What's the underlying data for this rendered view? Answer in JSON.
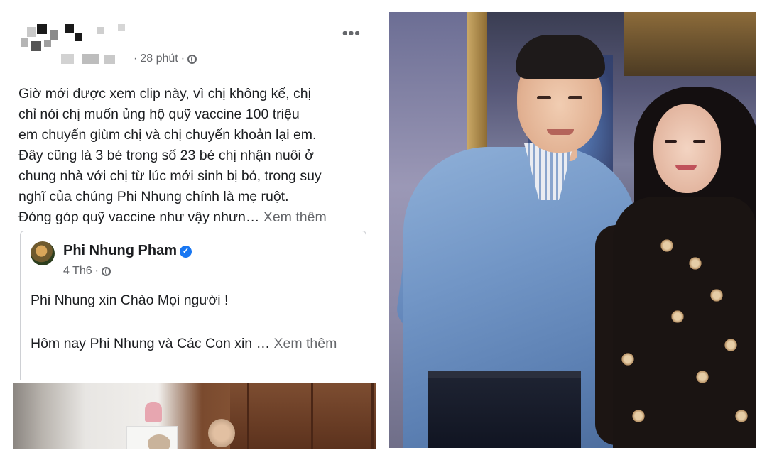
{
  "post": {
    "time_ago": "28 phút",
    "separator": "·",
    "more_label": "•••",
    "body_lines": [
      "Giờ mới được xem clip này, vì chị không kể, chị",
      "chỉ nói chị muốn ủng hộ quỹ vaccine 100 triệu",
      "em chuyển giùm chị và chị chuyển khoản lại em.",
      "Đây cũng là 3 bé trong số 23 bé chị nhận nuôi ở",
      "chung nhà với chị từ lúc mới sinh bị bỏ, trong suy",
      "nghĩ của chúng Phi Nhung chính là mẹ ruột.",
      "Đóng góp quỹ vaccine như vậy nhưn…"
    ],
    "see_more": "Xem thêm"
  },
  "shared_post": {
    "author": "Phi Nhung Pham",
    "verified_icon": "verified-badge-icon",
    "date": "4 Th6",
    "separator": "·",
    "line1": "Phi Nhung xin Chào Mọi người !",
    "line2": "Hôm nay Phi Nhung và Các Con xin …",
    "see_more": "Xem thêm"
  },
  "colors": {
    "text": "#1c1e21",
    "muted": "#65676b",
    "verified_blue": "#1877f2",
    "border": "#ced0d4"
  }
}
